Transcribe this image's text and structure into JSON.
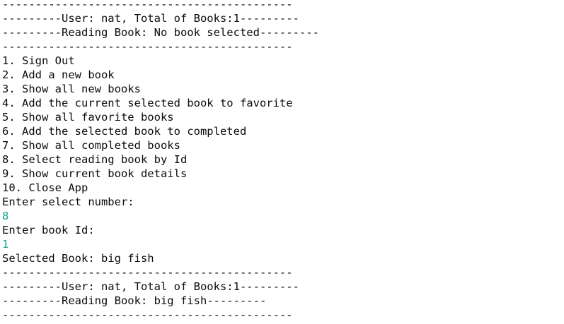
{
  "terminal": {
    "lines": [
      {
        "text": "--------------------------------------------",
        "kind": "separator"
      },
      {
        "text": "---------User: nat, Total of Books:1---------",
        "kind": "header"
      },
      {
        "text": "---------Reading Book: No book selected---------",
        "kind": "header"
      },
      {
        "text": "--------------------------------------------",
        "kind": "separator"
      },
      {
        "text": "1. Sign Out",
        "kind": "menu-item"
      },
      {
        "text": "2. Add a new book",
        "kind": "menu-item"
      },
      {
        "text": "3. Show all new books",
        "kind": "menu-item"
      },
      {
        "text": "4. Add the current selected book to favorite",
        "kind": "menu-item"
      },
      {
        "text": "5. Show all favorite books",
        "kind": "menu-item"
      },
      {
        "text": "6. Add the selected book to completed",
        "kind": "menu-item"
      },
      {
        "text": "7. Show all completed books",
        "kind": "menu-item"
      },
      {
        "text": "8. Select reading book by Id",
        "kind": "menu-item"
      },
      {
        "text": "9. Show current book details",
        "kind": "menu-item"
      },
      {
        "text": "10. Close App",
        "kind": "menu-item"
      },
      {
        "text": "Enter select number:",
        "kind": "prompt"
      },
      {
        "text": "8",
        "kind": "user-input"
      },
      {
        "text": "Enter book Id:",
        "kind": "prompt"
      },
      {
        "text": "1",
        "kind": "user-input"
      },
      {
        "text": "Selected Book: big fish",
        "kind": "output"
      },
      {
        "text": "--------------------------------------------",
        "kind": "separator"
      },
      {
        "text": "---------User: nat, Total of Books:1---------",
        "kind": "header"
      },
      {
        "text": "---------Reading Book: big fish---------",
        "kind": "header"
      },
      {
        "text": "--------------------------------------------",
        "kind": "separator"
      }
    ]
  },
  "colors": {
    "text": "#0c0c0c",
    "input": "#13a392",
    "background": "#ffffff"
  }
}
